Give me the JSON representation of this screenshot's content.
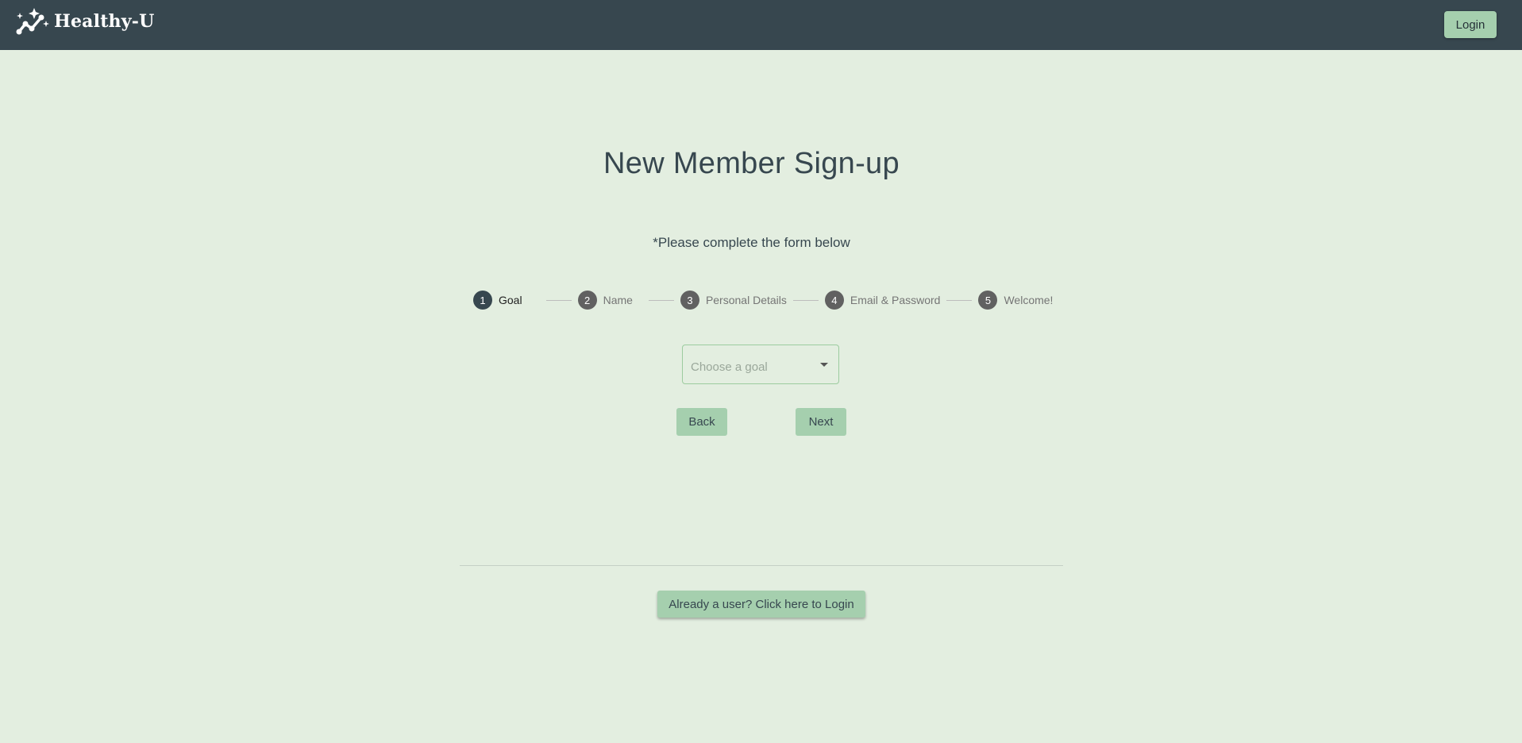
{
  "header": {
    "brand_name": "Healthy-U",
    "logo_icon": "sparkle-trend-icon",
    "login_label": "Login"
  },
  "main": {
    "title": "New Member Sign-up",
    "subtitle": "*Please complete the form below",
    "steps": [
      {
        "number": "1",
        "label": "Goal",
        "active": true
      },
      {
        "number": "2",
        "label": "Name",
        "active": false
      },
      {
        "number": "3",
        "label": "Personal Details",
        "active": false
      },
      {
        "number": "4",
        "label": "Email & Password",
        "active": false
      },
      {
        "number": "5",
        "label": "Welcome!",
        "active": false
      }
    ],
    "goal_select": {
      "placeholder": "Choose a goal",
      "value": ""
    },
    "back_label": "Back",
    "next_label": "Next",
    "already_user_label": "Already a user? Click here to Login"
  },
  "colors": {
    "header_bg": "#37474f",
    "page_bg": "#e3eee0",
    "button_bg": "#a5cfae",
    "active_step": "#37474f",
    "inactive_step": "#616161"
  }
}
